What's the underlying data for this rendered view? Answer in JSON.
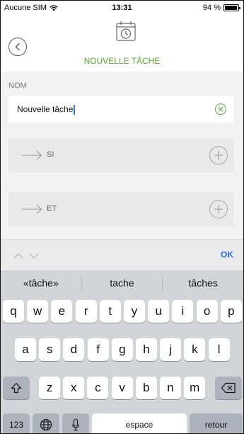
{
  "status_bar": {
    "carrier": "Aucune SIM",
    "time": "13:31",
    "battery": "94 %",
    "battery_level": 0.94
  },
  "header": {
    "title": "NOUVELLE TÂCHE"
  },
  "form": {
    "name_label": "NOM",
    "name_value": "Nouvelle tâche"
  },
  "rows": [
    {
      "label": "SI"
    },
    {
      "label": "ET"
    }
  ],
  "toolbar": {
    "ok_label": "OK"
  },
  "keyboard": {
    "suggestions": [
      "«tâche»",
      "tache",
      "tâches"
    ],
    "row1": [
      "q",
      "w",
      "e",
      "r",
      "t",
      "y",
      "u",
      "i",
      "o",
      "p"
    ],
    "row2": [
      "a",
      "s",
      "d",
      "f",
      "g",
      "h",
      "j",
      "k",
      "l"
    ],
    "row3": [
      "z",
      "x",
      "c",
      "v",
      "b",
      "n",
      "m"
    ],
    "numbers_label": "123",
    "space_label": "espace",
    "return_label": "retour"
  },
  "colors": {
    "accent_green": "#5aa632",
    "accent_blue": "#2a6ff2"
  }
}
